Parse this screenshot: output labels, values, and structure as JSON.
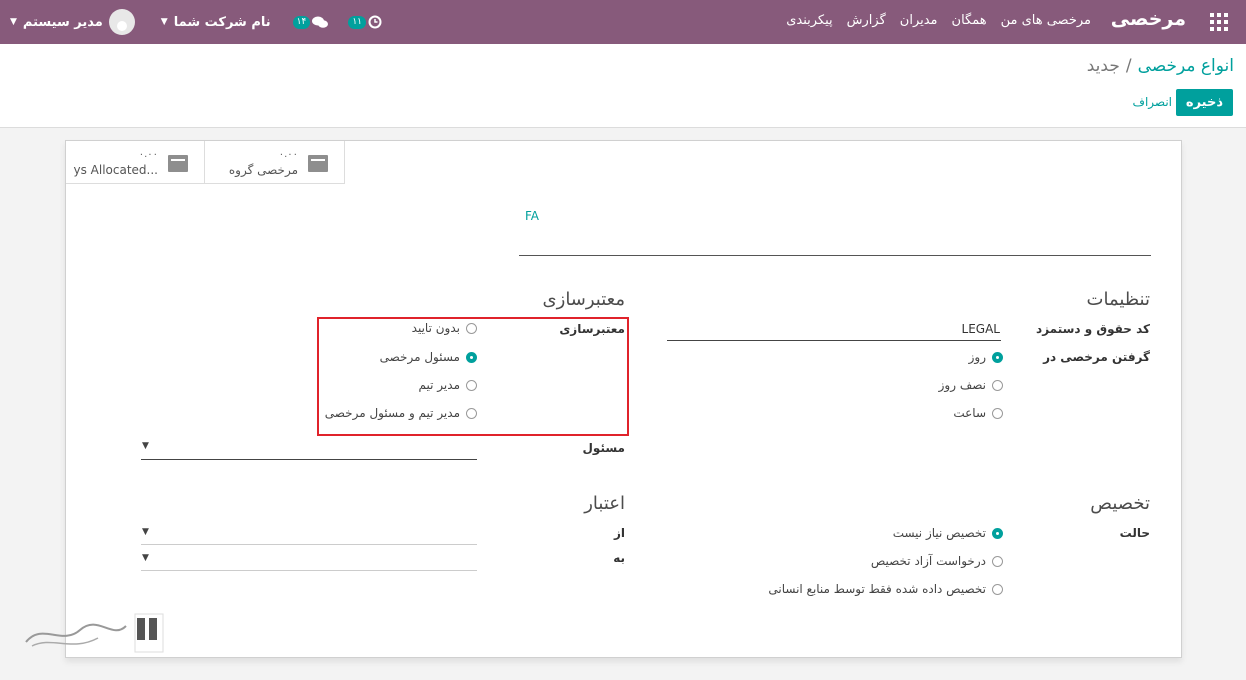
{
  "navbar": {
    "brand": "مرخصی",
    "menu": [
      "مرخصی های من",
      "همگان",
      "مدیران",
      "گزارش",
      "پیکربندی"
    ],
    "activity_count": "۱۱",
    "message_count": "۱۴",
    "company": "نام شرکت شما",
    "user": "مدیر سیستم"
  },
  "breadcrumb": {
    "parent": "انواع مرخصی",
    "separator": "/",
    "current": "جدید"
  },
  "buttons": {
    "save": "ذخیره",
    "discard": "انصراف"
  },
  "stat_buttons": [
    {
      "value": "۰.۰۰",
      "label": "ys Allocated..."
    },
    {
      "value": "۰.۰۰",
      "label": "مرخصی گروه"
    }
  ],
  "name_field": "FA",
  "settings": {
    "title": "تنظیمات",
    "code_label": "کد حقوق و دستمزد",
    "code_value": "LEGAL",
    "take_label": "گرفتن مرخصی در",
    "take_options": [
      {
        "label": "روز",
        "checked": true
      },
      {
        "label": "نصف روز",
        "checked": false
      },
      {
        "label": "ساعت",
        "checked": false
      }
    ]
  },
  "validation": {
    "title": "معتبرسازی",
    "label": "معتبرسازی",
    "options": [
      {
        "label": "بدون تایید",
        "checked": false
      },
      {
        "label": "مسئول مرخصی",
        "checked": true
      },
      {
        "label": "مدیر تیم",
        "checked": false
      },
      {
        "label": "مدیر تیم و مسئول مرخصی",
        "checked": false
      }
    ],
    "responsible_label": "مسئول"
  },
  "allocation": {
    "title": "تخصیص",
    "mode_label": "حالت",
    "options": [
      {
        "label": "تخصیص نیاز نیست",
        "checked": true
      },
      {
        "label": "درخواست آزاد تخصیص",
        "checked": false
      },
      {
        "label": "تخصیص داده شده فقط توسط منابع انسانی",
        "checked": false
      }
    ]
  },
  "validity": {
    "title": "اعتبار",
    "from_label": "از",
    "to_label": "به"
  },
  "colors": {
    "brand": "#875a7b",
    "accent": "#00a09d",
    "highlight": "#e0232b"
  }
}
